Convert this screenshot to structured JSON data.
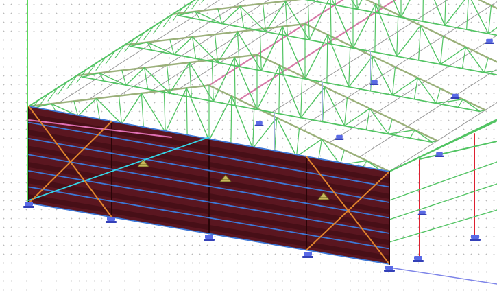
{
  "viewport": {
    "type": "3D structural model view",
    "colors": {
      "background": "#ffffff",
      "grid_dots": "#b9b9b9",
      "truss": "#52c463",
      "truss_dark": "#2e8f3c",
      "rafter": "#9bb07a",
      "purlin": "#9a9a9a",
      "purlin_pink": "#d77aa8",
      "cladding": "#5a1620",
      "cladding_dark": "#3b0c13",
      "girt": "#3e78d6",
      "brace": "#e0842d",
      "brace_pink": "#e070b5",
      "cyan_member": "#33d6e8",
      "column_red": "#dd2030",
      "support": "#5a6ae6",
      "load_symbol": "#c8b85a",
      "axis_green": "#22cc22",
      "axis_blue": "#7d84e8"
    },
    "icons": [
      "support-icon",
      "load-marker-icon"
    ]
  }
}
